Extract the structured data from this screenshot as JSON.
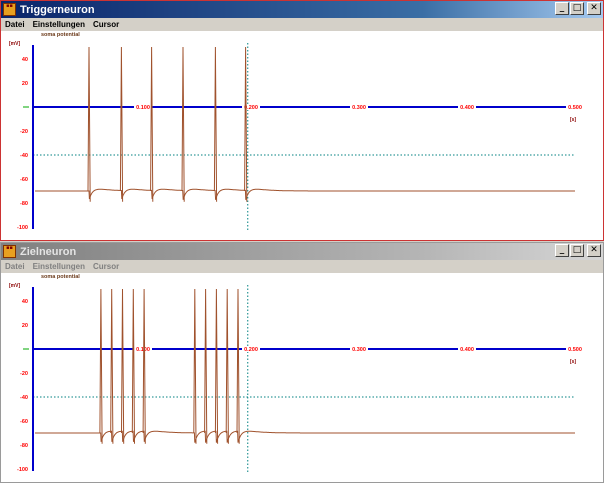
{
  "windows": [
    {
      "title": "Triggerneuron",
      "active": true,
      "menu": [
        "Datei",
        "Einstellungen",
        "Cursor"
      ],
      "chart_data": {
        "type": "line",
        "title": "soma potential",
        "ylabel": "[mV]",
        "xlabel": "[s]",
        "ylim": [
          -100,
          50
        ],
        "xlim": [
          0,
          0.5
        ],
        "y_ticks": [
          "40",
          "20",
          "-20",
          "-40",
          "-60",
          "-80",
          "-100"
        ],
        "x_ticks": [
          "0.100",
          "0.200",
          "0.300",
          "0.400",
          "0.500"
        ],
        "threshold_line": -40,
        "cursor_x": 0.197,
        "series": [
          {
            "resting": -70,
            "spike_peak": 50,
            "spikes": [
              0.05,
              0.08,
              0.108,
              0.137,
              0.167,
              0.195
            ]
          }
        ],
        "colors": {
          "trace": "#a0522d",
          "axis": "#0000cc",
          "threshold": "#008080",
          "ticks": "#ff0000"
        }
      }
    },
    {
      "title": "Zielneuron",
      "active": false,
      "menu": [
        "Datei",
        "Einstellungen",
        "Cursor"
      ],
      "chart_data": {
        "type": "line",
        "title": "soma potential",
        "ylabel": "[mV]",
        "xlabel": "[s]",
        "ylim": [
          -100,
          50
        ],
        "xlim": [
          0,
          0.5
        ],
        "y_ticks": [
          "40",
          "20",
          "-20",
          "-40",
          "-60",
          "-80",
          "-100"
        ],
        "x_ticks": [
          "0.100",
          "0.200",
          "0.300",
          "0.400",
          "0.500"
        ],
        "threshold_line": -40,
        "cursor_x": 0.197,
        "series": [
          {
            "resting": -70,
            "spike_peak": 50,
            "spikes": [
              0.061,
              0.071,
              0.081,
              0.091,
              0.101,
              0.148,
              0.158,
              0.168,
              0.178,
              0.188
            ]
          }
        ],
        "colors": {
          "trace": "#a0522d",
          "axis": "#0000cc",
          "threshold": "#008080",
          "ticks": "#ff0000"
        }
      }
    }
  ]
}
